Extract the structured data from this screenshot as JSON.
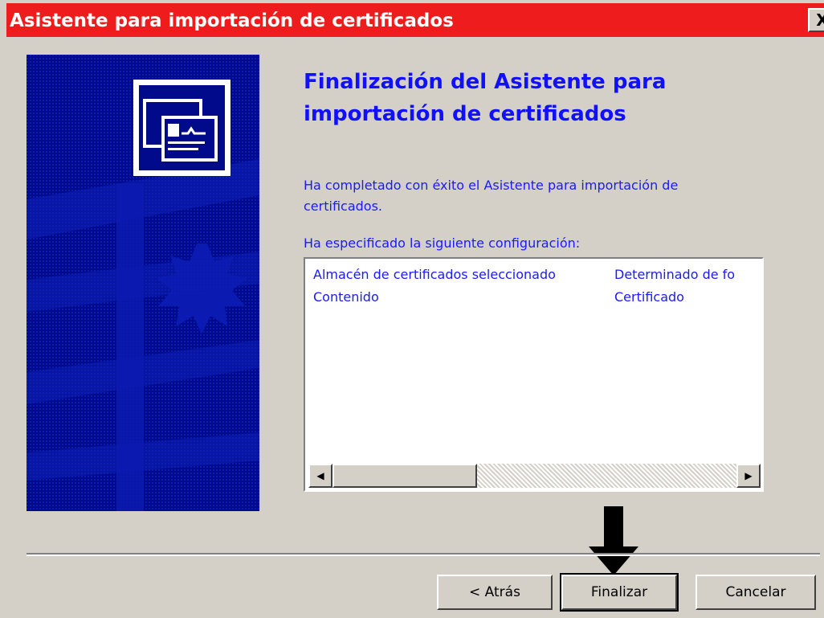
{
  "window": {
    "title": "Asistente para importación de certificados",
    "close_glyph": "X"
  },
  "heading": {
    "line1": "Finalización del Asistente para",
    "line2": "importación de certificados"
  },
  "message": {
    "line1": "Ha completado con éxito el Asistente para importación de",
    "line2": "certificados."
  },
  "config_label": "Ha especificado la siguiente configuración:",
  "settings": [
    {
      "name": "Almacén de certificados seleccionado",
      "value": "Determinado de fo"
    },
    {
      "name": "Contenido",
      "value": "Certificado"
    }
  ],
  "scrollbar": {
    "left_icon": "arrow-left-icon",
    "right_icon": "arrow-right-icon",
    "left_glyph": "◀",
    "right_glyph": "▶"
  },
  "buttons": {
    "back": "< Atrás",
    "finish": "Finalizar",
    "cancel": "Cancelar"
  },
  "icons": {
    "certificate": "certificate-icon",
    "pointer": "down-arrow-pointer-icon"
  },
  "colors": {
    "title_bar": "#ee1c1c",
    "side_panel": "#000a8a",
    "text": "#1a1aff",
    "dialog_bg": "#d4d0c8"
  }
}
